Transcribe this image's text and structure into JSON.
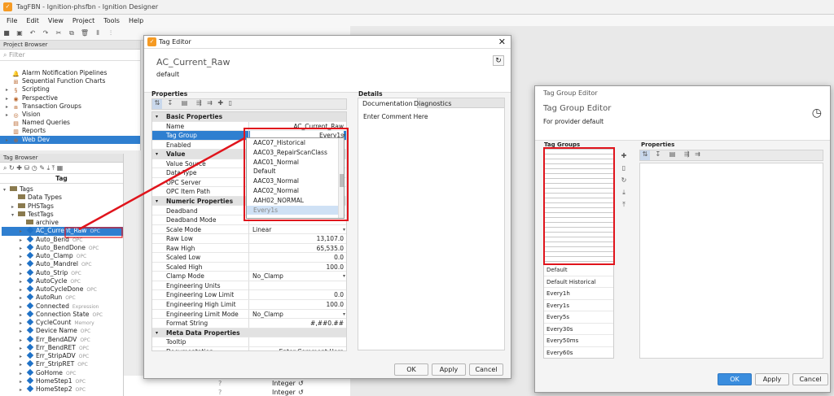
{
  "app": {
    "title": "TagFBN - Ignition-phsfbn - Ignition Designer"
  },
  "menu": [
    "File",
    "Edit",
    "View",
    "Project",
    "Tools",
    "Help"
  ],
  "project_browser": {
    "title": "Project Browser",
    "filter_placeholder": "Filter",
    "items": [
      {
        "label": "Alarm Notification Pipelines",
        "icon": "bell-icon",
        "arrow": ""
      },
      {
        "label": "Sequential Function Charts",
        "icon": "chart-icon",
        "arrow": ""
      },
      {
        "label": "Scripting",
        "icon": "script-icon",
        "arrow": "▸"
      },
      {
        "label": "Perspective",
        "icon": "perspective-icon",
        "arrow": "▸"
      },
      {
        "label": "Transaction Groups",
        "icon": "group-icon",
        "arrow": "▸"
      },
      {
        "label": "Vision",
        "icon": "eye-icon",
        "arrow": "▸"
      },
      {
        "label": "Named Queries",
        "icon": "query-icon",
        "arrow": ""
      },
      {
        "label": "Reports",
        "icon": "report-icon",
        "arrow": ""
      },
      {
        "label": "Web Dev",
        "icon": "globe-icon",
        "arrow": "▸"
      }
    ]
  },
  "tag_browser": {
    "title": "Tag Browser",
    "column": "Tag",
    "rows": [
      {
        "label": "Tags",
        "hint": "",
        "indent": 0,
        "kind": "folder",
        "arrow": "▾"
      },
      {
        "label": "Data Types",
        "hint": "",
        "indent": 1,
        "kind": "folder",
        "arrow": ""
      },
      {
        "label": "PHSTags",
        "hint": "",
        "indent": 1,
        "kind": "folder",
        "arrow": "▸"
      },
      {
        "label": "TestTags",
        "hint": "",
        "indent": 1,
        "kind": "folder",
        "arrow": "▾"
      },
      {
        "label": "archive",
        "hint": "",
        "indent": 2,
        "kind": "folder",
        "arrow": ""
      },
      {
        "label": "AC_Current_Raw",
        "hint": "OPC",
        "indent": 2,
        "kind": "tag",
        "arrow": "▸",
        "selected": true
      },
      {
        "label": "Auto_Bend",
        "hint": "OPC",
        "indent": 2,
        "kind": "tag",
        "arrow": "▸"
      },
      {
        "label": "Auto_BendDone",
        "hint": "OPC",
        "indent": 2,
        "kind": "tag",
        "arrow": "▸"
      },
      {
        "label": "Auto_Clamp",
        "hint": "OPC",
        "indent": 2,
        "kind": "tag",
        "arrow": "▸"
      },
      {
        "label": "Auto_Mandrel",
        "hint": "OPC",
        "indent": 2,
        "kind": "tag",
        "arrow": "▸"
      },
      {
        "label": "Auto_Strip",
        "hint": "OPC",
        "indent": 2,
        "kind": "tag",
        "arrow": "▸"
      },
      {
        "label": "AutoCycle",
        "hint": "OPC",
        "indent": 2,
        "kind": "tag",
        "arrow": "▸"
      },
      {
        "label": "AutoCycleDone",
        "hint": "OPC",
        "indent": 2,
        "kind": "tag",
        "arrow": "▸"
      },
      {
        "label": "AutoRun",
        "hint": "OPC",
        "indent": 2,
        "kind": "tag",
        "arrow": "▸"
      },
      {
        "label": "Connected",
        "hint": "Expression",
        "indent": 2,
        "kind": "tag",
        "arrow": "▸"
      },
      {
        "label": "Connection State",
        "hint": "OPC",
        "indent": 2,
        "kind": "tag",
        "arrow": "▸"
      },
      {
        "label": "CycleCount",
        "hint": "Memory",
        "indent": 2,
        "kind": "tag",
        "arrow": "▸"
      },
      {
        "label": "Device Name",
        "hint": "OPC",
        "indent": 2,
        "kind": "tag",
        "arrow": "▸"
      },
      {
        "label": "Err_BendADV",
        "hint": "OPC",
        "indent": 2,
        "kind": "tag",
        "arrow": "▸"
      },
      {
        "label": "Err_BendRET",
        "hint": "OPC",
        "indent": 2,
        "kind": "tag",
        "arrow": "▸"
      },
      {
        "label": "Err_StripADV",
        "hint": "OPC",
        "indent": 2,
        "kind": "tag",
        "arrow": "▸"
      },
      {
        "label": "Err_StripRET",
        "hint": "OPC",
        "indent": 2,
        "kind": "tag",
        "arrow": "▸"
      },
      {
        "label": "GoHome",
        "hint": "OPC",
        "indent": 2,
        "kind": "tag",
        "arrow": "▸"
      },
      {
        "label": "HomeStep1",
        "hint": "OPC",
        "indent": 2,
        "kind": "tag",
        "arrow": "▸"
      },
      {
        "label": "HomeStep2",
        "hint": "OPC",
        "indent": 2,
        "kind": "tag",
        "arrow": "▸"
      }
    ],
    "bg_types": [
      "Integer",
      "Integer"
    ]
  },
  "tag_editor": {
    "window_title": "Tag Editor",
    "tag_name": "AC_Current_Raw",
    "provider": "default",
    "properties_label": "Properties",
    "details_label": "Details",
    "tabs": [
      "Documentation",
      "Diagnostics"
    ],
    "comment_placeholder": "Enter Comment Here",
    "props": [
      {
        "name": "Basic Properties",
        "section": true
      },
      {
        "name": "Name",
        "value": "AC_Current_Raw",
        "align": "right"
      },
      {
        "name": "Tag Group",
        "value": "Every1s",
        "highlight": true,
        "align": "right"
      },
      {
        "name": "Enabled",
        "value": ""
      },
      {
        "name": "Value",
        "section": true
      },
      {
        "name": "Value Source",
        "value": ""
      },
      {
        "name": "Data Type",
        "value": ""
      },
      {
        "name": "OPC Server",
        "value": ""
      },
      {
        "name": "OPC Item Path",
        "value": ""
      },
      {
        "name": "Numeric Properties",
        "section": true
      },
      {
        "name": "Deadband",
        "value": ""
      },
      {
        "name": "Deadband Mode",
        "value": ""
      },
      {
        "name": "Scale Mode",
        "value": "Linear",
        "combo": true
      },
      {
        "name": "Raw Low",
        "value": "13,107.0",
        "align": "right"
      },
      {
        "name": "Raw High",
        "value": "65,535.0",
        "align": "right"
      },
      {
        "name": "Scaled Low",
        "value": "0.0",
        "align": "right"
      },
      {
        "name": "Scaled High",
        "value": "100.0",
        "align": "right"
      },
      {
        "name": "Clamp Mode",
        "value": "No_Clamp",
        "combo": true
      },
      {
        "name": "Engineering Units",
        "value": ""
      },
      {
        "name": "Engineering Low Limit",
        "value": "0.0",
        "align": "right"
      },
      {
        "name": "Engineering High Limit",
        "value": "100.0",
        "align": "right"
      },
      {
        "name": "Engineering Limit Mode",
        "value": "No_Clamp",
        "combo": true
      },
      {
        "name": "Format String",
        "value": "#,##0.##",
        "align": "right"
      },
      {
        "name": "Meta Data Properties",
        "section": true
      },
      {
        "name": "Tooltip",
        "value": ""
      },
      {
        "name": "Documentation",
        "value": "Enter Comment Here",
        "align": "right"
      }
    ],
    "dropdown": [
      "AAC07_Historical",
      "AAC03_RepairScanClass",
      "AAC01_Normal",
      "Default",
      "AAC03_Normal",
      "AAC02_Normal",
      "AAH02_NORMAL",
      "Every1s"
    ],
    "buttons": {
      "ok": "OK",
      "apply": "Apply",
      "cancel": "Cancel"
    }
  },
  "tag_group_editor": {
    "window_title": "Tag Group Editor",
    "heading": "Tag Group Editor",
    "subtitle": "For provider default",
    "list_label": "Tag Groups",
    "properties_label": "Properties",
    "groups": [
      "Default",
      "Default Historical",
      "Every1h",
      "Every1s",
      "Every5s",
      "Every30s",
      "Every50ms",
      "Every60s"
    ],
    "buttons": {
      "ok": "OK",
      "apply": "Apply",
      "cancel": "Cancel"
    }
  },
  "colors": {
    "highlight": "#e0141c",
    "selection": "#2f7fd0",
    "accent": "#3a8dde"
  }
}
